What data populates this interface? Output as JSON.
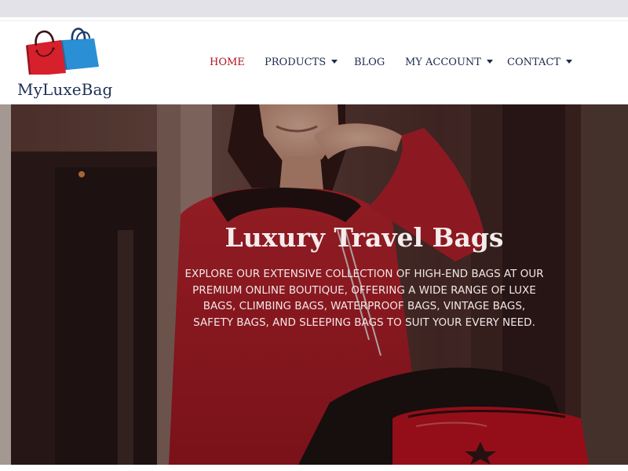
{
  "brand": {
    "name": "MyLuxeBag",
    "colors": {
      "primary_bag": "#d6202c",
      "secondary_bag": "#2a8fd4",
      "text": "#1f2f56"
    }
  },
  "nav": {
    "items": [
      {
        "label": "HOME",
        "active": true
      },
      {
        "label": "PRODUCTS",
        "dropdown": true
      },
      {
        "label": "BLOG"
      },
      {
        "label": "MY ACCOUNT",
        "dropdown": true
      },
      {
        "label": "CONTACT",
        "dropdown": true
      }
    ],
    "colors": {
      "active": "#b3121f",
      "default": "#1b2a4e"
    }
  },
  "hero": {
    "title": "Luxury Travel Bags",
    "description": "EXPLORE OUR EXTENSIVE COLLECTION OF HIGH-END BAGS AT OUR PREMIUM ONLINE BOUTIQUE, OFFERING A WIDE RANGE OF LUXE BAGS, CLIMBING BAGS, WATERPROOF BAGS, VINTAGE BAGS, SAFETY BAGS, AND SLEEPING BAGS TO SUIT YOUR EVERY NEED."
  }
}
